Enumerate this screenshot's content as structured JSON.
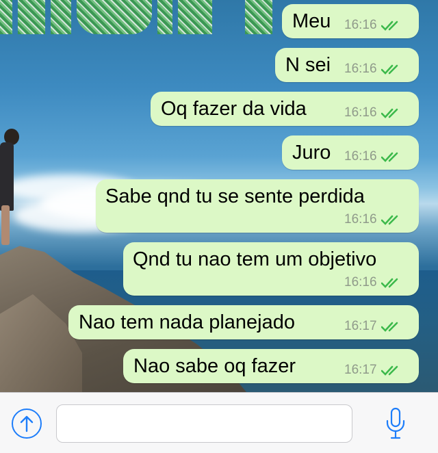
{
  "messages": [
    {
      "text": "Meu",
      "time": "16:16",
      "status": "read"
    },
    {
      "text": "N sei",
      "time": "16:16",
      "status": "read"
    },
    {
      "text": "Oq fazer da vida",
      "time": "16:16",
      "status": "read"
    },
    {
      "text": "Juro",
      "time": "16:16",
      "status": "read"
    },
    {
      "text": "Sabe qnd tu se sente perdida",
      "time": "16:16",
      "status": "read"
    },
    {
      "text": "Qnd tu nao tem um objetivo",
      "time": "16:16",
      "status": "read"
    },
    {
      "text": "Nao tem nada planejado",
      "time": "16:17",
      "status": "read"
    },
    {
      "text": "Nao sabe oq fazer",
      "time": "16:17",
      "status": "read"
    }
  ],
  "input": {
    "value": "",
    "placeholder": ""
  },
  "icons": {
    "attach": "arrow-up-circle-icon",
    "mic": "microphone-icon",
    "ticks": "double-check-icon"
  },
  "colors": {
    "bubble": "#dcf8c6",
    "ticks": "#3cb94b",
    "accent": "#1d7dfa"
  }
}
